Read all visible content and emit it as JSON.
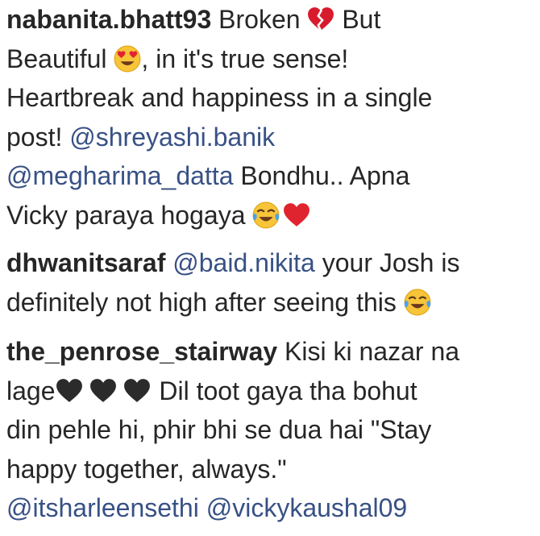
{
  "comments": [
    {
      "username": "nabanita.bhatt93",
      "lines": [
        {
          "a": "Broken ",
          "b": " But"
        },
        {
          "a": "Beautiful ",
          "b": ", in it's true sense!"
        },
        {
          "a": "Heartbreak and happiness in a single"
        },
        {
          "a": "post! ",
          "mention": "@shreyashi.banik"
        },
        {
          "mention": "@megharima_datta",
          "a": " Bondhu.. Apna"
        },
        {
          "a": "Vicky paraya hogaya "
        }
      ],
      "emojis": [
        "broken-heart-icon",
        "heart-eyes-emoji-icon",
        "tears-of-joy-emoji-icon",
        "red-heart-icon"
      ]
    },
    {
      "username": "dhwanitsaraf",
      "lines": [
        {
          "mention": "@baid.nikita",
          "a": " your Josh is"
        },
        {
          "a": "definitely not high after seeing this "
        }
      ],
      "emojis": [
        "tears-of-joy-emoji-icon"
      ]
    },
    {
      "username": "the_penrose_stairway",
      "lines": [
        {
          "a": " Kisi ki nazar na"
        },
        {
          "a": "lage",
          "b": " Dil toot gaya tha bohut"
        },
        {
          "a": "din pehle hi, phir bhi se dua hai \"Stay"
        },
        {
          "a": "happy together, always.\""
        },
        {
          "mention": "@itsharleensethi",
          "mention2": "@vickykaushal09"
        }
      ],
      "emojis": [
        "black-heart-icon",
        "black-heart-icon",
        "black-heart-icon"
      ]
    }
  ],
  "colors": {
    "text": "#262626",
    "mention": "#385185"
  }
}
